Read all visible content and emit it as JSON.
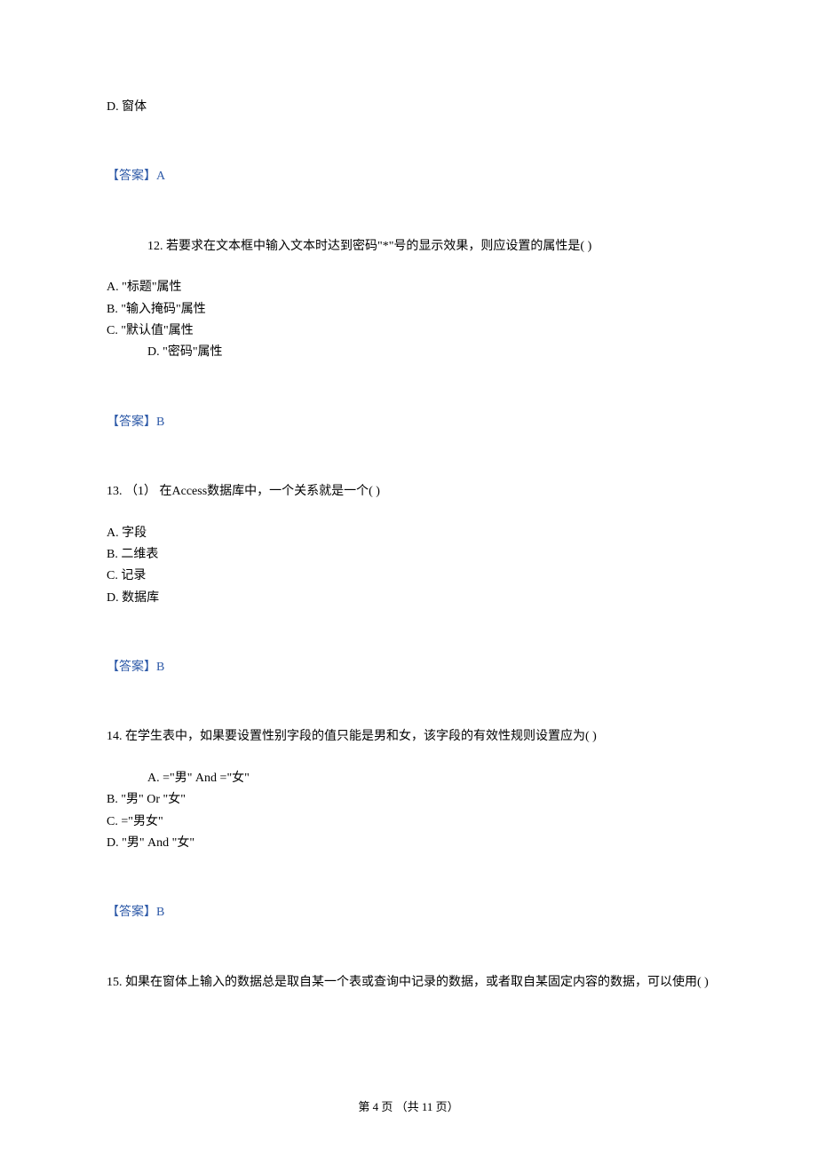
{
  "q11": {
    "optD": "D.  窗体",
    "answer": "【答案】A"
  },
  "q12": {
    "stem": "12.  若要求在文本框中输入文本时达到密码\"*\"号的显示效果，则应设置的属性是(    )",
    "optA": "A.  \"标题\"属性",
    "optB": "B.  \"输入掩码\"属性",
    "optC": "C.  \"默认值\"属性",
    "optD": "D.  \"密码\"属性",
    "answer": "【答案】B"
  },
  "q13": {
    "stem": "13.  （1）    在Access数据库中，一个关系就是一个(    )",
    "optA": "A.  字段",
    "optB": "B.  二维表",
    "optC": "C.  记录",
    "optD": "D.  数据库",
    "answer": "【答案】B"
  },
  "q14": {
    "stem": "14.  在学生表中，如果要设置性别字段的值只能是男和女，该字段的有效性规则设置应为(    )",
    "optA": "A.  =\"男\"   And   =\"女\"",
    "optB": "B.  \"男\"    Or    \"女\"",
    "optC": "C.   =\"男女\"",
    "optD": "D.  \"男\"    And    \"女\"",
    "answer": "【答案】B"
  },
  "q15": {
    "stem": "15.  如果在窗体上输入的数据总是取自某一个表或查询中记录的数据，或者取自某固定内容的数据，可以使用(    )"
  },
  "footer": {
    "text": "第 4 页 （共 11 页）"
  }
}
